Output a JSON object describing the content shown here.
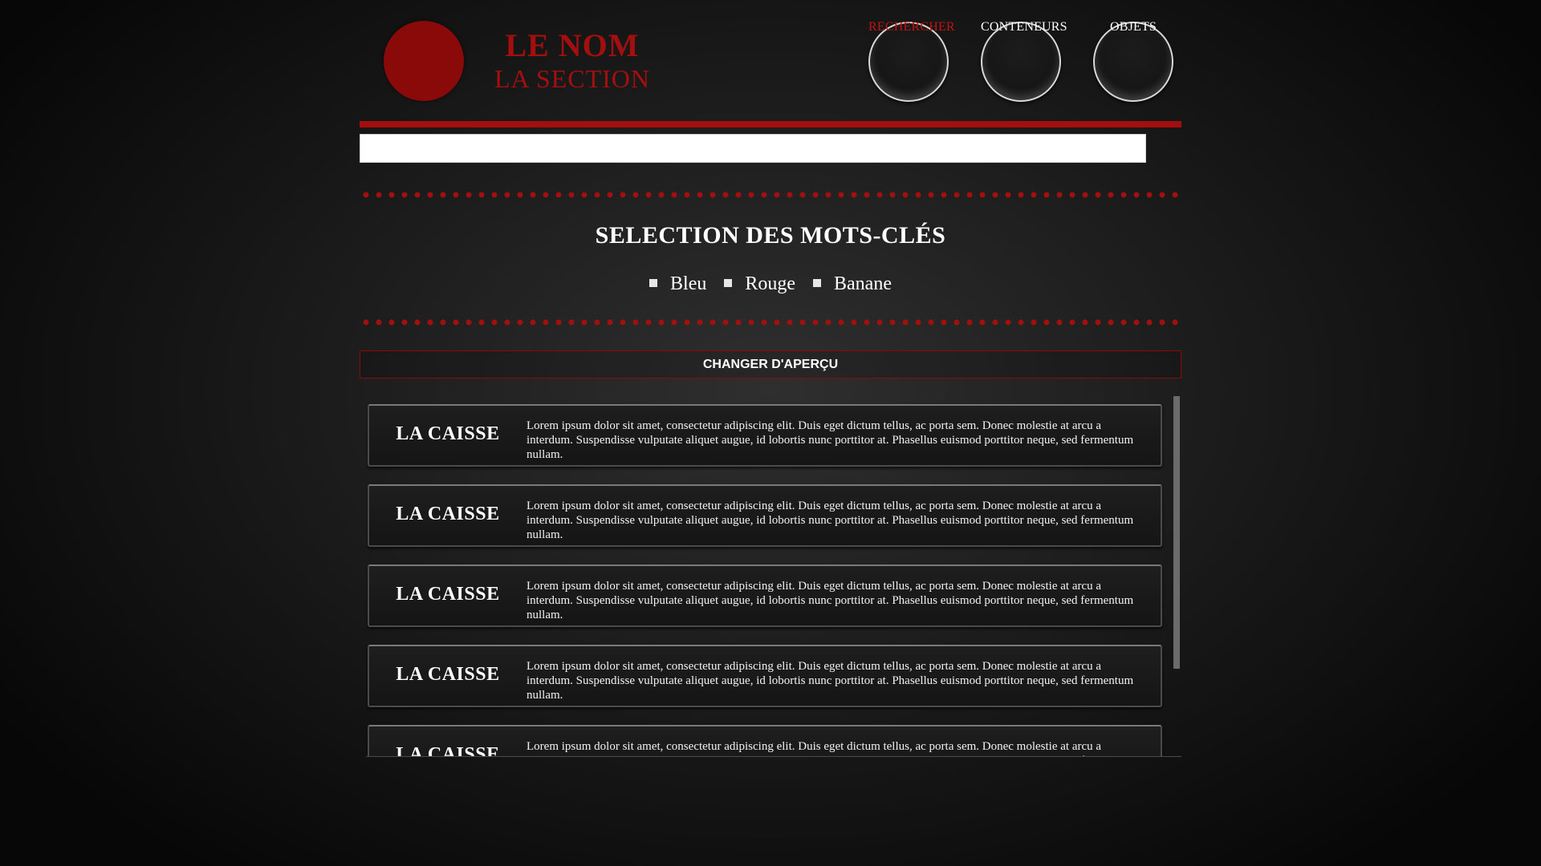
{
  "header": {
    "brand_name": "LE NOM",
    "brand_section": "LA SECTION",
    "nav": [
      {
        "label": "RECHERCHER",
        "active": true
      },
      {
        "label": "CONTENEURS",
        "active": false
      },
      {
        "label": "OBJETS",
        "active": false
      }
    ]
  },
  "search": {
    "value": "",
    "placeholder": ""
  },
  "keywords": {
    "title": "SELECTION DES MOTS-CLÉS",
    "items": [
      "Bleu",
      "Rouge",
      "Banane"
    ]
  },
  "view_toggle": {
    "label": "CHANGER D'APERÇU"
  },
  "results": [
    {
      "title": "LA CAISSE",
      "description": "Lorem ipsum dolor sit amet, consectetur adipiscing elit. Duis eget dictum tellus, ac porta sem. Donec molestie at arcu a interdum. Suspendisse vulputate aliquet augue, id lobortis nunc porttitor at. Phasellus euismod porttitor neque, sed fermentum nullam."
    },
    {
      "title": "LA CAISSE",
      "description": "Lorem ipsum dolor sit amet, consectetur adipiscing elit. Duis eget dictum tellus, ac porta sem. Donec molestie at arcu a interdum. Suspendisse vulputate aliquet augue, id lobortis nunc porttitor at. Phasellus euismod porttitor neque, sed fermentum nullam."
    },
    {
      "title": "LA CAISSE",
      "description": "Lorem ipsum dolor sit amet, consectetur adipiscing elit. Duis eget dictum tellus, ac porta sem. Donec molestie at arcu a interdum. Suspendisse vulputate aliquet augue, id lobortis nunc porttitor at. Phasellus euismod porttitor neque, sed fermentum nullam."
    },
    {
      "title": "LA CAISSE",
      "description": "Lorem ipsum dolor sit amet, consectetur adipiscing elit. Duis eget dictum tellus, ac porta sem. Donec molestie at arcu a interdum. Suspendisse vulputate aliquet augue, id lobortis nunc porttitor at. Phasellus euismod porttitor neque, sed fermentum nullam."
    },
    {
      "title": "LA CAISSE",
      "description": "Lorem ipsum dolor sit amet, consectetur adipiscing elit. Duis eget dictum tellus, ac porta sem. Donec molestie at arcu a interdum. Suspendisse vulputate aliquet augue, id lobortis nunc porttitor at. Phasellus euismod porttitor neque, sed fermentum nullam."
    }
  ],
  "colors": {
    "accent": "#a30f0f",
    "logo": "#8a0a0a",
    "background": "#1a1a1a"
  }
}
